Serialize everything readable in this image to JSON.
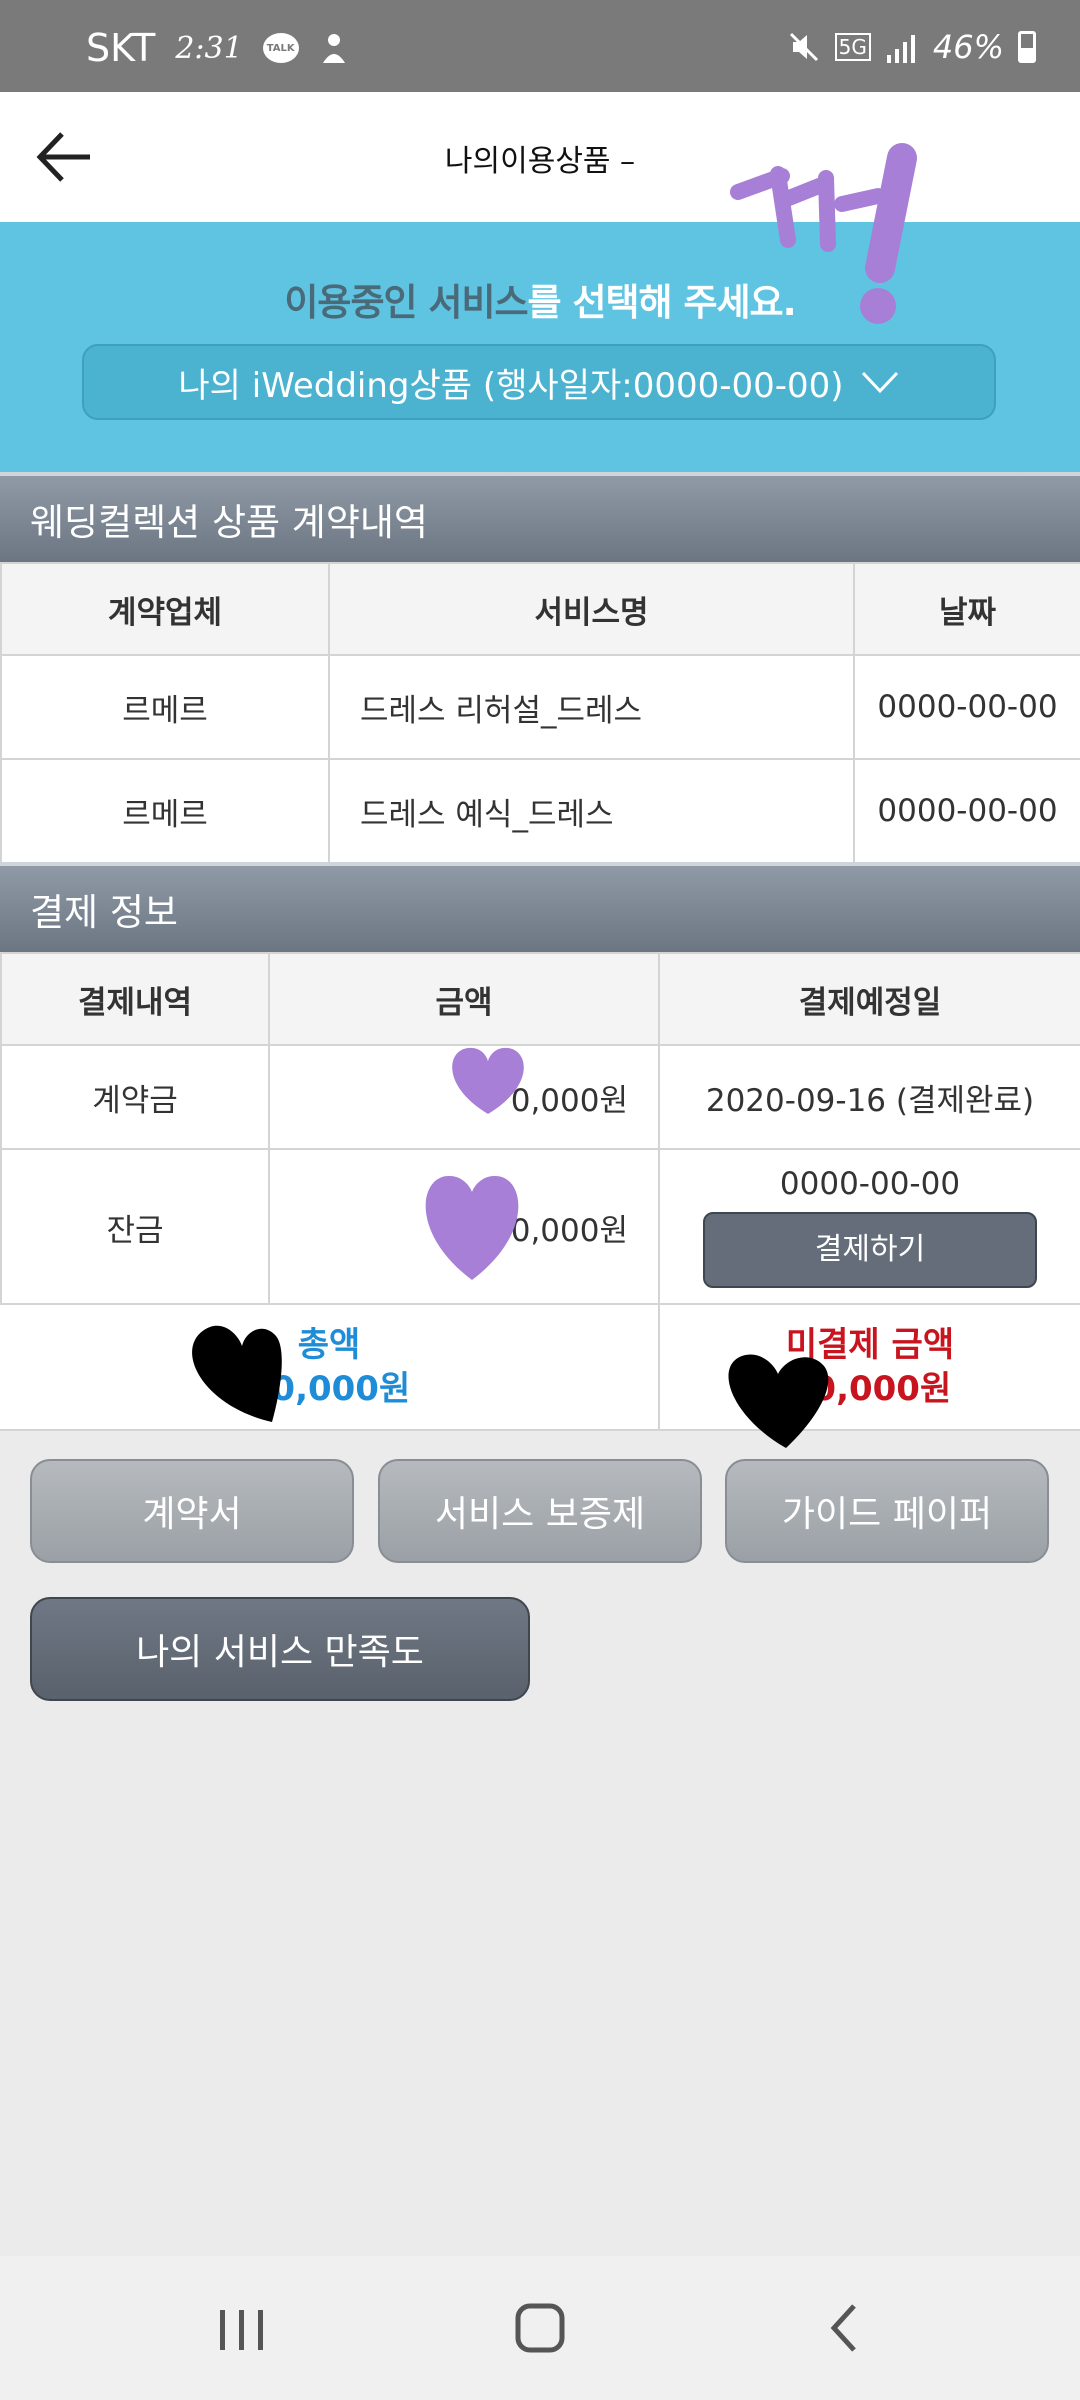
{
  "status_bar": {
    "carrier": "SKT",
    "time": "2:31",
    "talk_badge": "TALK",
    "network": "5G",
    "battery": "46%"
  },
  "header": {
    "title": "나의이용상품 –"
  },
  "banner": {
    "prompt_highlight_1": "이용중인 서비스",
    "prompt_text": "를 선택해 주세요.",
    "selected_product": "나의 iWedding상품 (행사일자:0000-00-00)"
  },
  "contract_section": {
    "title": "웨딩컬렉션 상품 계약내역",
    "columns": [
      "계약업체",
      "서비스명",
      "날짜"
    ],
    "rows": [
      {
        "vendor": "르메르",
        "service": "드레스 리허설_드레스",
        "date": "0000-00-00"
      },
      {
        "vendor": "르메르",
        "service": "드레스 예식_드레스",
        "date": "0000-00-00"
      }
    ]
  },
  "payment_section": {
    "title": "결제 정보",
    "columns": [
      "결제내역",
      "금액",
      "결제예정일"
    ],
    "rows": [
      {
        "item": "계약금",
        "amount": "0,000원",
        "due": "2020-09-16 (결제완료)"
      },
      {
        "item": "잔금",
        "amount": "0,000원",
        "due": "0000-00-00",
        "action": "결제하기"
      }
    ],
    "total_label": "총액",
    "total_value": "00,000원",
    "unpaid_label": "미결제 금액",
    "unpaid_value": "00,000원"
  },
  "buttons": {
    "contract": "계약서",
    "warranty": "서비스 보증제",
    "guide": "가이드 페이퍼",
    "satisfaction": "나의 서비스 만족도"
  },
  "doodle_text": "까!",
  "colors": {
    "banner": "#5ec4e2",
    "total_blue": "#1e8cd6",
    "unpaid_red": "#c8141e",
    "doodle_purple": "#a87fd6"
  }
}
